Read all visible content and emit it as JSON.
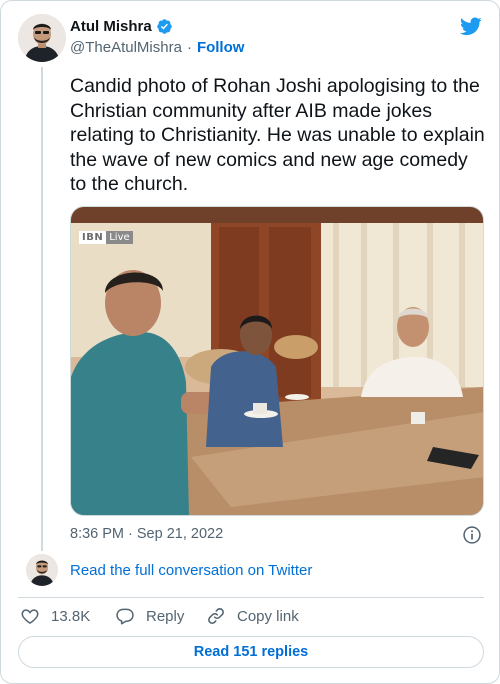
{
  "author": {
    "name": "Atul Mishra",
    "handle": "@TheAtulMishra",
    "separator": "·",
    "follow_label": "Follow",
    "verified": true
  },
  "tweet": {
    "text": "Candid photo of Rohan Joshi apologising to the Christian community after AIB made jokes relating to Christianity. He was unable to explain the wave of new comics and new age comedy to the church.",
    "timestamp": "8:36 PM · Sep 21, 2022"
  },
  "photo": {
    "watermark_ibn": "IBN",
    "watermark_live": "Live"
  },
  "conversation": {
    "read_full_label": "Read the full conversation on Twitter"
  },
  "actions": {
    "like_count": "13.8K",
    "reply_label": "Reply",
    "copy_link_label": "Copy link"
  },
  "footer": {
    "read_replies_label": "Read 151 replies"
  },
  "colors": {
    "brand_blue": "#1d9bf0",
    "link_blue": "#006fd6",
    "text_primary": "#0f1419",
    "text_secondary": "#536471",
    "border": "#cfd9de"
  },
  "icons": {
    "logo": "twitter-bird-icon",
    "verified": "verified-badge-icon",
    "info": "info-icon",
    "like": "heart-icon",
    "reply": "speech-bubble-icon",
    "copy_link": "link-icon"
  }
}
